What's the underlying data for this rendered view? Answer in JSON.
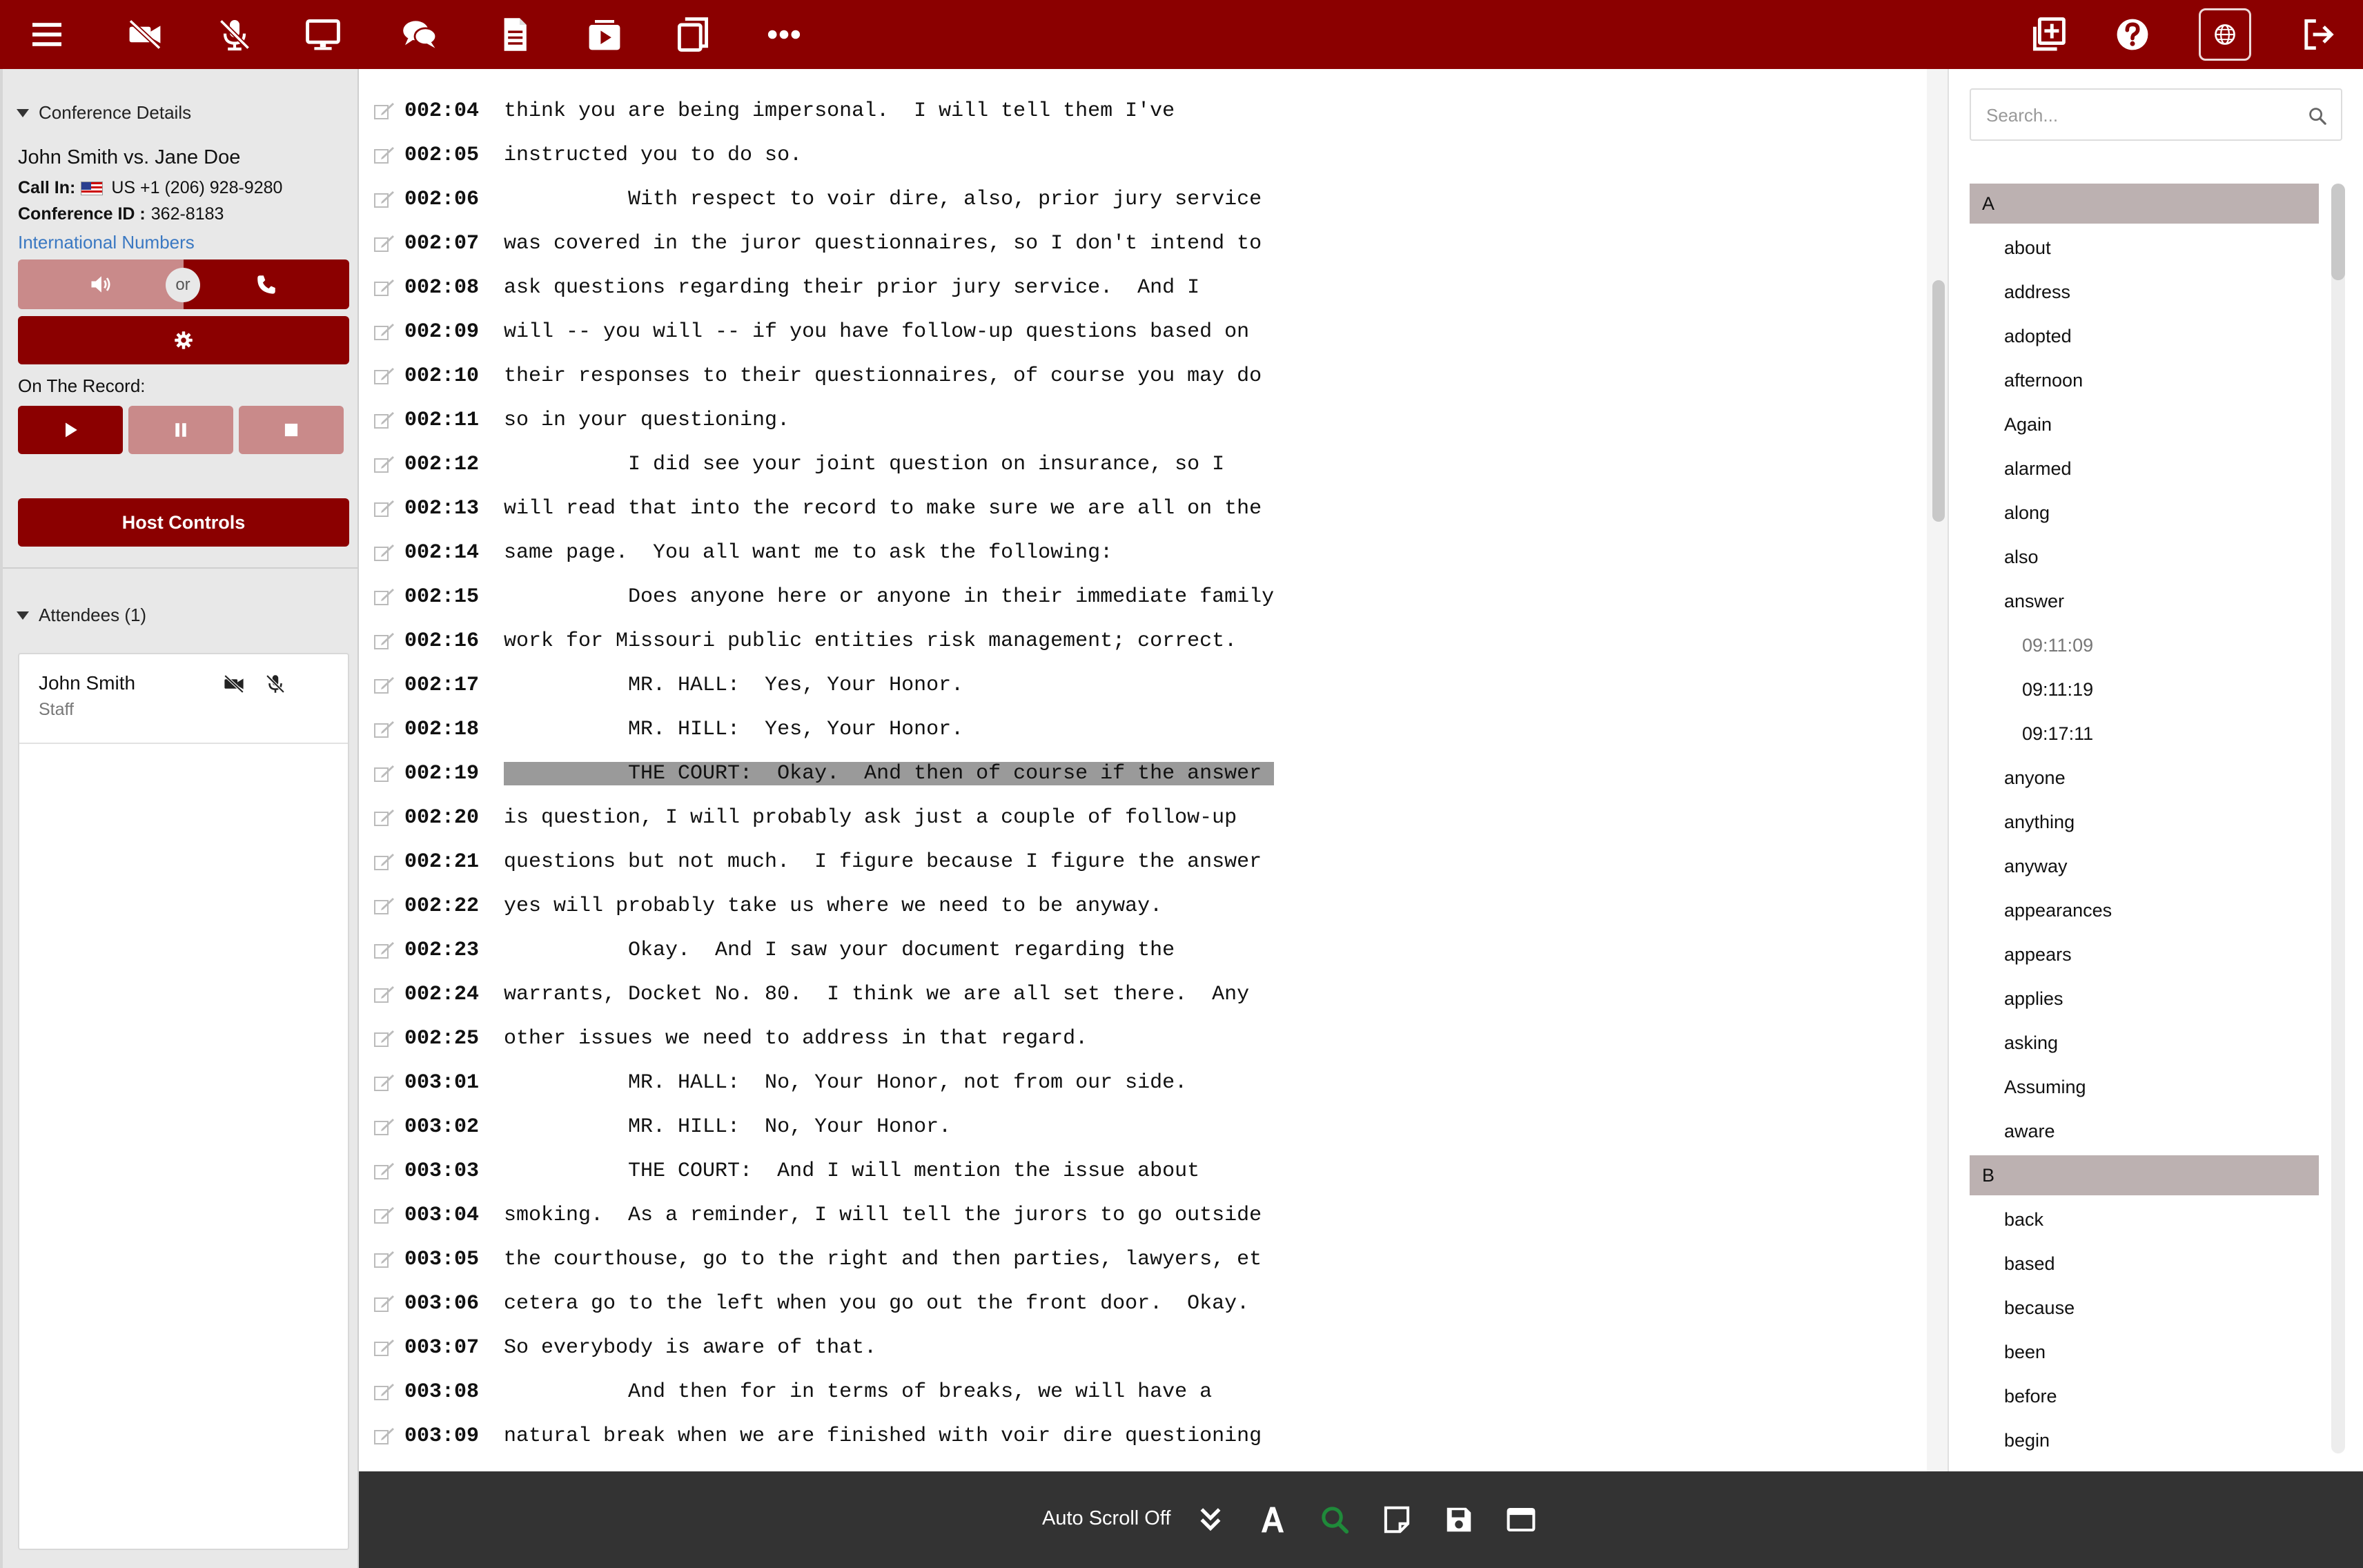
{
  "conference": {
    "section_title": "Conference Details",
    "case_title": "John Smith vs. Jane Doe",
    "call_in_label": "Call In:",
    "call_in_number": "US +1 (206) 928-9280",
    "conference_id_label": "Conference ID :",
    "conference_id": "362-8183",
    "international_link": "International Numbers",
    "or_label": "or",
    "record_label": "On The Record:",
    "host_controls_label": "Host Controls"
  },
  "attendees": {
    "section_title": "Attendees (1)",
    "items": [
      {
        "name": "John Smith",
        "role": "Staff"
      }
    ]
  },
  "transcript": {
    "lines": [
      {
        "num": "002:04",
        "text": "think you are being impersonal.  I will tell them I've"
      },
      {
        "num": "002:05",
        "text": "instructed you to do so."
      },
      {
        "num": "002:06",
        "text": "          With respect to voir dire, also, prior jury service"
      },
      {
        "num": "002:07",
        "text": "was covered in the juror questionnaires, so I don't intend to"
      },
      {
        "num": "002:08",
        "text": "ask questions regarding their prior jury service.  And I"
      },
      {
        "num": "002:09",
        "text": "will -- you will -- if you have follow-up questions based on"
      },
      {
        "num": "002:10",
        "text": "their responses to their questionnaires, of course you may do"
      },
      {
        "num": "002:11",
        "text": "so in your questioning."
      },
      {
        "num": "002:12",
        "text": "          I did see your joint question on insurance, so I"
      },
      {
        "num": "002:13",
        "text": "will read that into the record to make sure we are all on the"
      },
      {
        "num": "002:14",
        "text": "same page.  You all want me to ask the following:"
      },
      {
        "num": "002:15",
        "text": "          Does anyone here or anyone in their immediate family"
      },
      {
        "num": "002:16",
        "text": "work for Missouri public entities risk management; correct."
      },
      {
        "num": "002:17",
        "text": "          MR. HALL:  Yes, Your Honor."
      },
      {
        "num": "002:18",
        "text": "          MR. HILL:  Yes, Your Honor."
      },
      {
        "num": "002:19",
        "text": "          THE COURT:  Okay.  And then of course if the answer "
      },
      {
        "num": "002:20",
        "text": "is question, I will probably ask just a couple of follow-up"
      },
      {
        "num": "002:21",
        "text": "questions but not much.  I figure because I figure the answer"
      },
      {
        "num": "002:22",
        "text": "yes will probably take us where we need to be anyway."
      },
      {
        "num": "002:23",
        "text": "          Okay.  And I saw your document regarding the"
      },
      {
        "num": "002:24",
        "text": "warrants, Docket No. 80.  I think we are all set there.  Any"
      },
      {
        "num": "002:25",
        "text": "other issues we need to address in that regard."
      },
      {
        "num": "003:01",
        "text": "          MR. HALL:  No, Your Honor, not from our side."
      },
      {
        "num": "003:02",
        "text": "          MR. HILL:  No, Your Honor."
      },
      {
        "num": "003:03",
        "text": "          THE COURT:  And I will mention the issue about"
      },
      {
        "num": "003:04",
        "text": "smoking.  As a reminder, I will tell the jurors to go outside"
      },
      {
        "num": "003:05",
        "text": "the courthouse, go to the right and then parties, lawyers, et"
      },
      {
        "num": "003:06",
        "text": "cetera go to the left when you go out the front door.  Okay."
      },
      {
        "num": "003:07",
        "text": "So everybody is aware of that."
      },
      {
        "num": "003:08",
        "text": "          And then for in terms of breaks, we will have a"
      },
      {
        "num": "003:09",
        "text": "natural break when we are finished with voir dire questioning"
      }
    ],
    "highlighted_index": 15
  },
  "index_panel": {
    "search_placeholder": "Search...",
    "groups": [
      {
        "letter": "A",
        "words": [
          {
            "word": "about"
          },
          {
            "word": "address"
          },
          {
            "word": "adopted"
          },
          {
            "word": "afternoon"
          },
          {
            "word": "Again"
          },
          {
            "word": "alarmed"
          },
          {
            "word": "along"
          },
          {
            "word": "also"
          },
          {
            "word": "answer",
            "times": [
              "09:11:09",
              "09:11:19",
              "09:17:11"
            ]
          },
          {
            "word": "anyone"
          },
          {
            "word": "anything"
          },
          {
            "word": "anyway"
          },
          {
            "word": "appearances"
          },
          {
            "word": "appears"
          },
          {
            "word": "applies"
          },
          {
            "word": "asking"
          },
          {
            "word": "Assuming"
          },
          {
            "word": "aware"
          }
        ]
      },
      {
        "letter": "B",
        "words": [
          {
            "word": "back"
          },
          {
            "word": "based"
          },
          {
            "word": "because"
          },
          {
            "word": "been"
          },
          {
            "word": "before"
          },
          {
            "word": "begin"
          }
        ]
      }
    ]
  },
  "bottom_bar": {
    "auto_scroll_label": "Auto Scroll Off"
  },
  "colors": {
    "brand": "#8b0000",
    "brand_muted": "#c98a8a",
    "highlight": "#9a9a9a",
    "index_header": "#bcb1b1",
    "link": "#3a78c2",
    "search_active": "#1f8a3a"
  }
}
